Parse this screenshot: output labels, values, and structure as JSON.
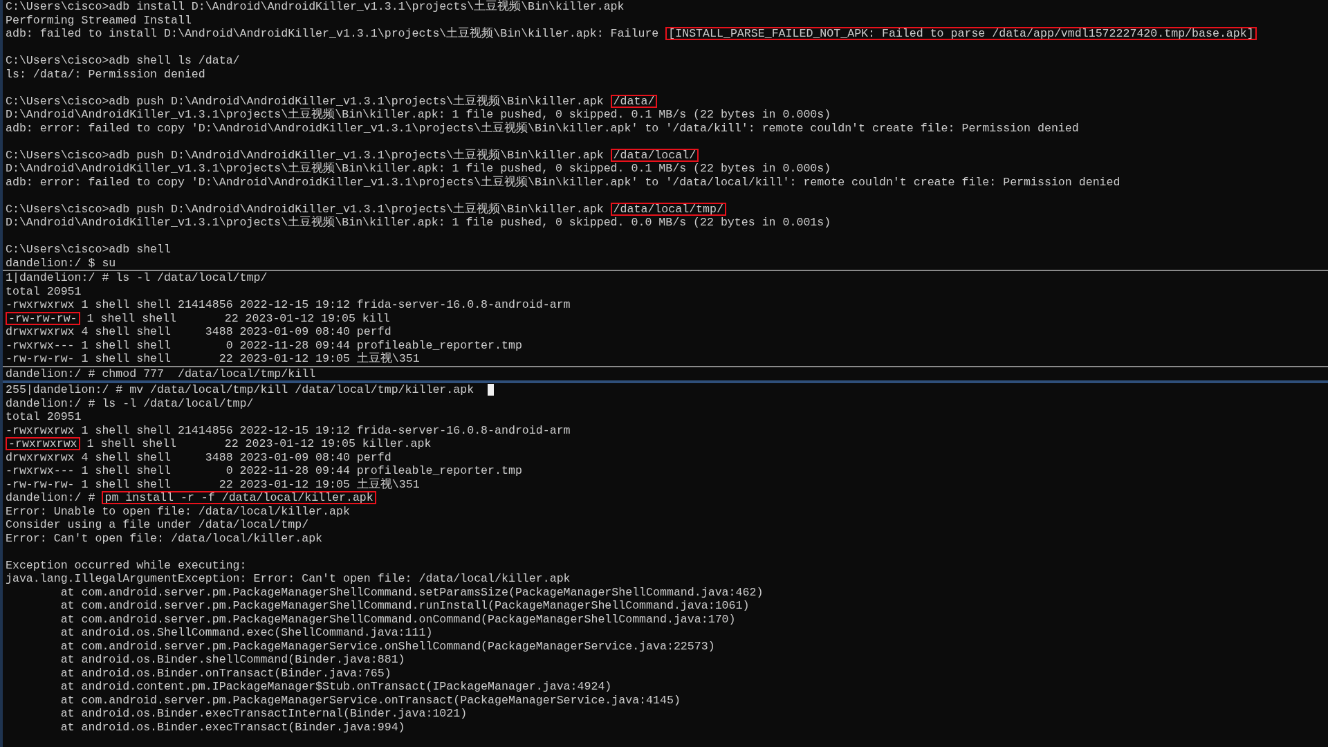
{
  "sections": [
    {
      "lines": [
        {
          "segments": [
            {
              "text": "C:\\Users\\cisco>adb install D:\\Android\\AndroidKiller_v1.3.1\\projects\\土豆视频\\Bin\\killer.apk",
              "boxed": false
            }
          ]
        },
        {
          "segments": [
            {
              "text": "Performing Streamed Install",
              "boxed": false
            }
          ]
        },
        {
          "segments": [
            {
              "text": "adb: failed to install D:\\Android\\AndroidKiller_v1.3.1\\projects\\土豆视频\\Bin\\killer.apk: Failure ",
              "boxed": false
            },
            {
              "text": "[INSTALL_PARSE_FAILED_NOT_APK: Failed to parse /data/app/vmdl1572227420.tmp/base.apk]",
              "boxed": true
            }
          ]
        },
        {
          "gap_before": true,
          "segments": [
            {
              "text": "C:\\Users\\cisco>adb shell ls /data/",
              "boxed": false
            }
          ]
        },
        {
          "segments": [
            {
              "text": "ls: /data/: Permission denied",
              "boxed": false
            }
          ]
        },
        {
          "gap_before": true,
          "segments": [
            {
              "text": "C:\\Users\\cisco>adb push D:\\Android\\AndroidKiller_v1.3.1\\projects\\土豆视频\\Bin\\killer.apk ",
              "boxed": false
            },
            {
              "text": "/data/",
              "boxed": true
            }
          ]
        },
        {
          "segments": [
            {
              "text": "D:\\Android\\AndroidKiller_v1.3.1\\projects\\土豆视频\\Bin\\killer.apk: 1 file pushed, 0 skipped. 0.1 MB/s (22 bytes in 0.000s)",
              "boxed": false
            }
          ]
        },
        {
          "segments": [
            {
              "text": "adb: error: failed to copy 'D:\\Android\\AndroidKiller_v1.3.1\\projects\\土豆视频\\Bin\\killer.apk' to '/data/kill': remote couldn't create file: Permission denied",
              "boxed": false
            }
          ]
        },
        {
          "gap_before": true,
          "segments": [
            {
              "text": "C:\\Users\\cisco>adb push D:\\Android\\AndroidKiller_v1.3.1\\projects\\土豆视频\\Bin\\killer.apk ",
              "boxed": false
            },
            {
              "text": "/data/local/",
              "boxed": true
            }
          ]
        },
        {
          "segments": [
            {
              "text": "D:\\Android\\AndroidKiller_v1.3.1\\projects\\土豆视频\\Bin\\killer.apk: 1 file pushed, 0 skipped. 0.1 MB/s (22 bytes in 0.000s)",
              "boxed": false
            }
          ]
        },
        {
          "segments": [
            {
              "text": "adb: error: failed to copy 'D:\\Android\\AndroidKiller_v1.3.1\\projects\\土豆视频\\Bin\\killer.apk' to '/data/local/kill': remote couldn't create file: Permission denied",
              "boxed": false
            }
          ]
        },
        {
          "gap_before": true,
          "segments": [
            {
              "text": "C:\\Users\\cisco>adb push D:\\Android\\AndroidKiller_v1.3.1\\projects\\土豆视频\\Bin\\killer.apk ",
              "boxed": false
            },
            {
              "text": "/data/local/tmp/",
              "boxed": true
            }
          ]
        },
        {
          "segments": [
            {
              "text": "D:\\Android\\AndroidKiller_v1.3.1\\projects\\土豆视频\\Bin\\killer.apk: 1 file pushed, 0 skipped. 0.0 MB/s (22 bytes in 0.001s)",
              "boxed": false
            }
          ]
        },
        {
          "gap_before": true,
          "segments": [
            {
              "text": "C:\\Users\\cisco>adb shell",
              "boxed": false
            }
          ]
        },
        {
          "segments": [
            {
              "text": "dandelion:/ $ su",
              "boxed": false
            }
          ]
        }
      ]
    },
    {
      "lines": [
        {
          "segments": [
            {
              "text": "1|dandelion:/ # ls -l /data/local/tmp/",
              "boxed": false
            }
          ]
        },
        {
          "segments": [
            {
              "text": "total 20951",
              "boxed": false
            }
          ]
        },
        {
          "segments": [
            {
              "text": "-rwxrwxrwx 1 shell shell 21414856 2022-12-15 19:12 frida-server-16.0.8-android-arm",
              "boxed": false
            }
          ]
        },
        {
          "segments": [
            {
              "text": "-rw-rw-rw-",
              "boxed": true
            },
            {
              "text": " 1 shell shell       22 2023-01-12 19:05 kill",
              "boxed": false
            }
          ]
        },
        {
          "segments": [
            {
              "text": "drwxrwxrwx 4 shell shell     3488 2023-01-09 08:40 perfd",
              "boxed": false
            }
          ]
        },
        {
          "segments": [
            {
              "text": "-rwxrwx--- 1 shell shell        0 2022-11-28 09:44 profileable_reporter.tmp",
              "boxed": false
            }
          ]
        },
        {
          "segments": [
            {
              "text": "-rw-rw-rw- 1 shell shell       22 2023-01-12 19:05 土豆视\\351",
              "boxed": false
            }
          ]
        }
      ]
    },
    {
      "lines": [
        {
          "segments": [
            {
              "text": "dandelion:/ # chmod 777  /data/local/tmp/kill",
              "boxed": false
            }
          ]
        }
      ]
    },
    {
      "lines": [
        {
          "segments": [
            {
              "text": "255|dandelion:/ # mv /data/local/tmp/kill /data/local/tmp/killer.apk ",
              "boxed": false
            }
          ],
          "cursor": true
        },
        {
          "segments": [
            {
              "text": "dandelion:/ # ls -l /data/local/tmp/",
              "boxed": false
            }
          ]
        },
        {
          "segments": [
            {
              "text": "total 20951",
              "boxed": false
            }
          ]
        },
        {
          "segments": [
            {
              "text": "-rwxrwxrwx 1 shell shell 21414856 2022-12-15 19:12 frida-server-16.0.8-android-arm",
              "boxed": false
            }
          ]
        },
        {
          "segments": [
            {
              "text": "-rwxrwxrwx",
              "boxed": true
            },
            {
              "text": " 1 shell shell       22 2023-01-12 19:05 killer.apk",
              "boxed": false
            }
          ]
        },
        {
          "segments": [
            {
              "text": "drwxrwxrwx 4 shell shell     3488 2023-01-09 08:40 perfd",
              "boxed": false
            }
          ]
        },
        {
          "segments": [
            {
              "text": "-rwxrwx--- 1 shell shell        0 2022-11-28 09:44 profileable_reporter.tmp",
              "boxed": false
            }
          ]
        },
        {
          "segments": [
            {
              "text": "-rw-rw-rw- 1 shell shell       22 2023-01-12 19:05 土豆视\\351",
              "boxed": false
            }
          ]
        },
        {
          "segments": [
            {
              "text": "dandelion:/ # ",
              "boxed": false
            },
            {
              "text": "pm install -r -f /data/local/killer.apk",
              "boxed": true
            }
          ]
        },
        {
          "segments": [
            {
              "text": "Error: Unable to open file: /data/local/killer.apk",
              "boxed": false
            }
          ]
        },
        {
          "segments": [
            {
              "text": "Consider using a file under /data/local/tmp/",
              "boxed": false
            }
          ]
        },
        {
          "segments": [
            {
              "text": "Error: Can't open file: /data/local/killer.apk",
              "boxed": false
            }
          ]
        },
        {
          "gap_before": true,
          "segments": [
            {
              "text": "Exception occurred while executing:",
              "boxed": false
            }
          ]
        },
        {
          "segments": [
            {
              "text": "java.lang.IllegalArgumentException: Error: Can't open file: /data/local/killer.apk",
              "boxed": false
            }
          ]
        },
        {
          "segments": [
            {
              "text": "        at com.android.server.pm.PackageManagerShellCommand.setParamsSize(PackageManagerShellCommand.java:462)",
              "boxed": false
            }
          ]
        },
        {
          "segments": [
            {
              "text": "        at com.android.server.pm.PackageManagerShellCommand.runInstall(PackageManagerShellCommand.java:1061)",
              "boxed": false
            }
          ]
        },
        {
          "segments": [
            {
              "text": "        at com.android.server.pm.PackageManagerShellCommand.onCommand(PackageManagerShellCommand.java:170)",
              "boxed": false
            }
          ]
        },
        {
          "segments": [
            {
              "text": "        at android.os.ShellCommand.exec(ShellCommand.java:111)",
              "boxed": false
            }
          ]
        },
        {
          "segments": [
            {
              "text": "        at com.android.server.pm.PackageManagerService.onShellCommand(PackageManagerService.java:22573)",
              "boxed": false
            }
          ]
        },
        {
          "segments": [
            {
              "text": "        at android.os.Binder.shellCommand(Binder.java:881)",
              "boxed": false
            }
          ]
        },
        {
          "segments": [
            {
              "text": "        at android.os.Binder.onTransact(Binder.java:765)",
              "boxed": false
            }
          ]
        },
        {
          "segments": [
            {
              "text": "        at android.content.pm.IPackageManager$Stub.onTransact(IPackageManager.java:4924)",
              "boxed": false
            }
          ]
        },
        {
          "segments": [
            {
              "text": "        at com.android.server.pm.PackageManagerService.onTransact(PackageManagerService.java:4145)",
              "boxed": false
            }
          ]
        },
        {
          "segments": [
            {
              "text": "        at android.os.Binder.execTransactInternal(Binder.java:1021)",
              "boxed": false
            }
          ]
        },
        {
          "segments": [
            {
              "text": "        at android.os.Binder.execTransact(Binder.java:994)",
              "boxed": false
            }
          ]
        }
      ]
    }
  ]
}
